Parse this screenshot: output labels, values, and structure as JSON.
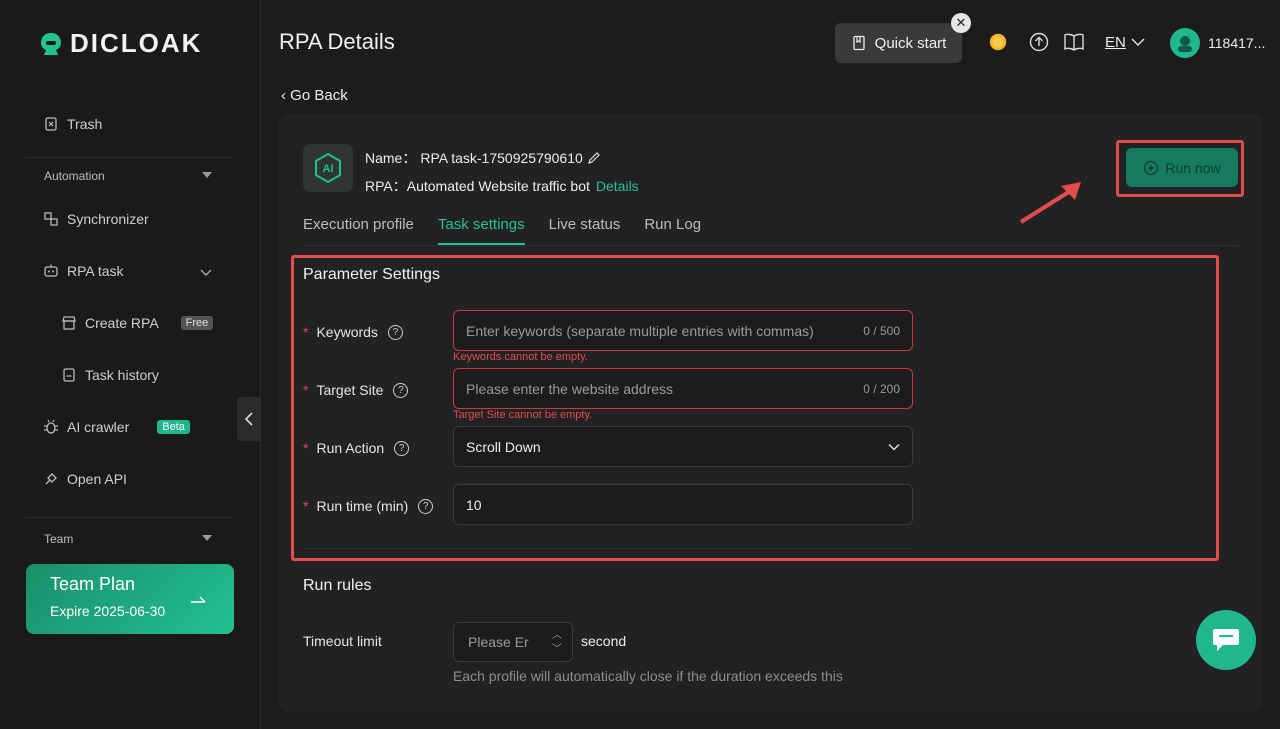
{
  "brand": {
    "name": "DICLOAK",
    "accent": "#21c190",
    "danger": "#e14c4c"
  },
  "sidebar": {
    "trash": "Trash",
    "automation_section": "Automation",
    "synchronizer": "Synchronizer",
    "rpa_task": "RPA task",
    "create_rpa": "Create RPA",
    "free_badge": "Free",
    "task_history": "Task history",
    "ai_crawler": "AI crawler",
    "beta_badge": "Beta",
    "open_api": "Open API",
    "team_section": "Team",
    "team_plan": {
      "title": "Team Plan",
      "expire": "Expire 2025-06-30"
    }
  },
  "header": {
    "title": "RPA Details",
    "quick_start": "Quick start",
    "language": "EN",
    "user": "118417..."
  },
  "go_back": "Go Back",
  "task": {
    "name_label": "Name：",
    "name_value": "RPA task-1750925790610",
    "rpa_label": "RPA：",
    "rpa_value": "Automated Website traffic bot",
    "details_link": "Details",
    "run_now": "Run now"
  },
  "tabs": [
    "Execution profile",
    "Task settings",
    "Live status",
    "Run Log"
  ],
  "parameter_settings": {
    "title": "Parameter Settings",
    "keywords": {
      "label": "Keywords",
      "placeholder": "Enter keywords (separate multiple entries with commas)",
      "count": "0 / 500",
      "error": "Keywords cannot be empty."
    },
    "target_site": {
      "label": "Target Site",
      "placeholder": "Please enter the website address",
      "count": "0 / 200",
      "error": "Target Site cannot be empty."
    },
    "run_action": {
      "label": "Run Action",
      "value": "Scroll Down"
    },
    "run_time": {
      "label": "Run time (min)",
      "value": "10"
    }
  },
  "run_rules": {
    "title": "Run rules",
    "timeout_label": "Timeout limit",
    "timeout_placeholder": "Please Er",
    "unit": "second",
    "hint": "Each profile will automatically close if the duration exceeds this"
  }
}
